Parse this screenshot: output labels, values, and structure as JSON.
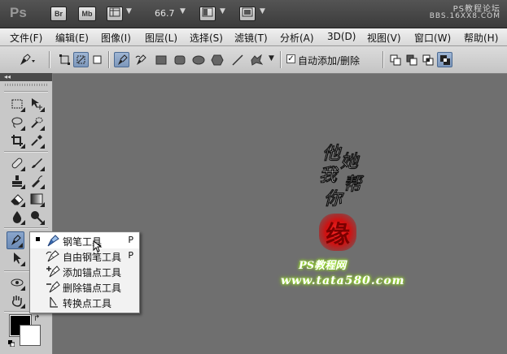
{
  "app": {
    "logo": "Ps",
    "bridge_button": "Br",
    "minibridge_button": "Mb",
    "zoom": "66.7",
    "watermark_name": "PS教程论坛",
    "watermark_url": "BBS.16XX8.COM"
  },
  "menu": [
    "文件(F)",
    "编辑(E)",
    "图像(I)",
    "图层(L)",
    "选择(S)",
    "滤镜(T)",
    "分析(A)",
    "3D(D)",
    "视图(V)",
    "窗口(W)",
    "帮助(H)"
  ],
  "options": {
    "auto_add_delete_label": "自动添加/删除",
    "auto_add_delete_checked": true
  },
  "flyout": [
    {
      "label": "钢笔工具",
      "key": "P",
      "icon": "pen-icon",
      "selected": true
    },
    {
      "label": "自由钢笔工具",
      "key": "P",
      "icon": "freeform-pen-icon",
      "selected": false
    },
    {
      "label": "添加锚点工具",
      "key": "",
      "icon": "add-anchor-icon",
      "selected": false
    },
    {
      "label": "删除锚点工具",
      "key": "",
      "icon": "delete-anchor-icon",
      "selected": false
    },
    {
      "label": "转换点工具",
      "key": "",
      "icon": "convert-point-icon",
      "selected": false
    }
  ],
  "colors": {
    "foreground": "#000000",
    "background": "#ffffff",
    "canvas": "#6f6f6f",
    "accent": "#7d97bb"
  },
  "artwork": {
    "calligraphy": [
      "他",
      "她",
      "我",
      "帮",
      "你"
    ],
    "seal_char": "缘",
    "brand": "PS教程网",
    "url": "www.tata580.com"
  }
}
